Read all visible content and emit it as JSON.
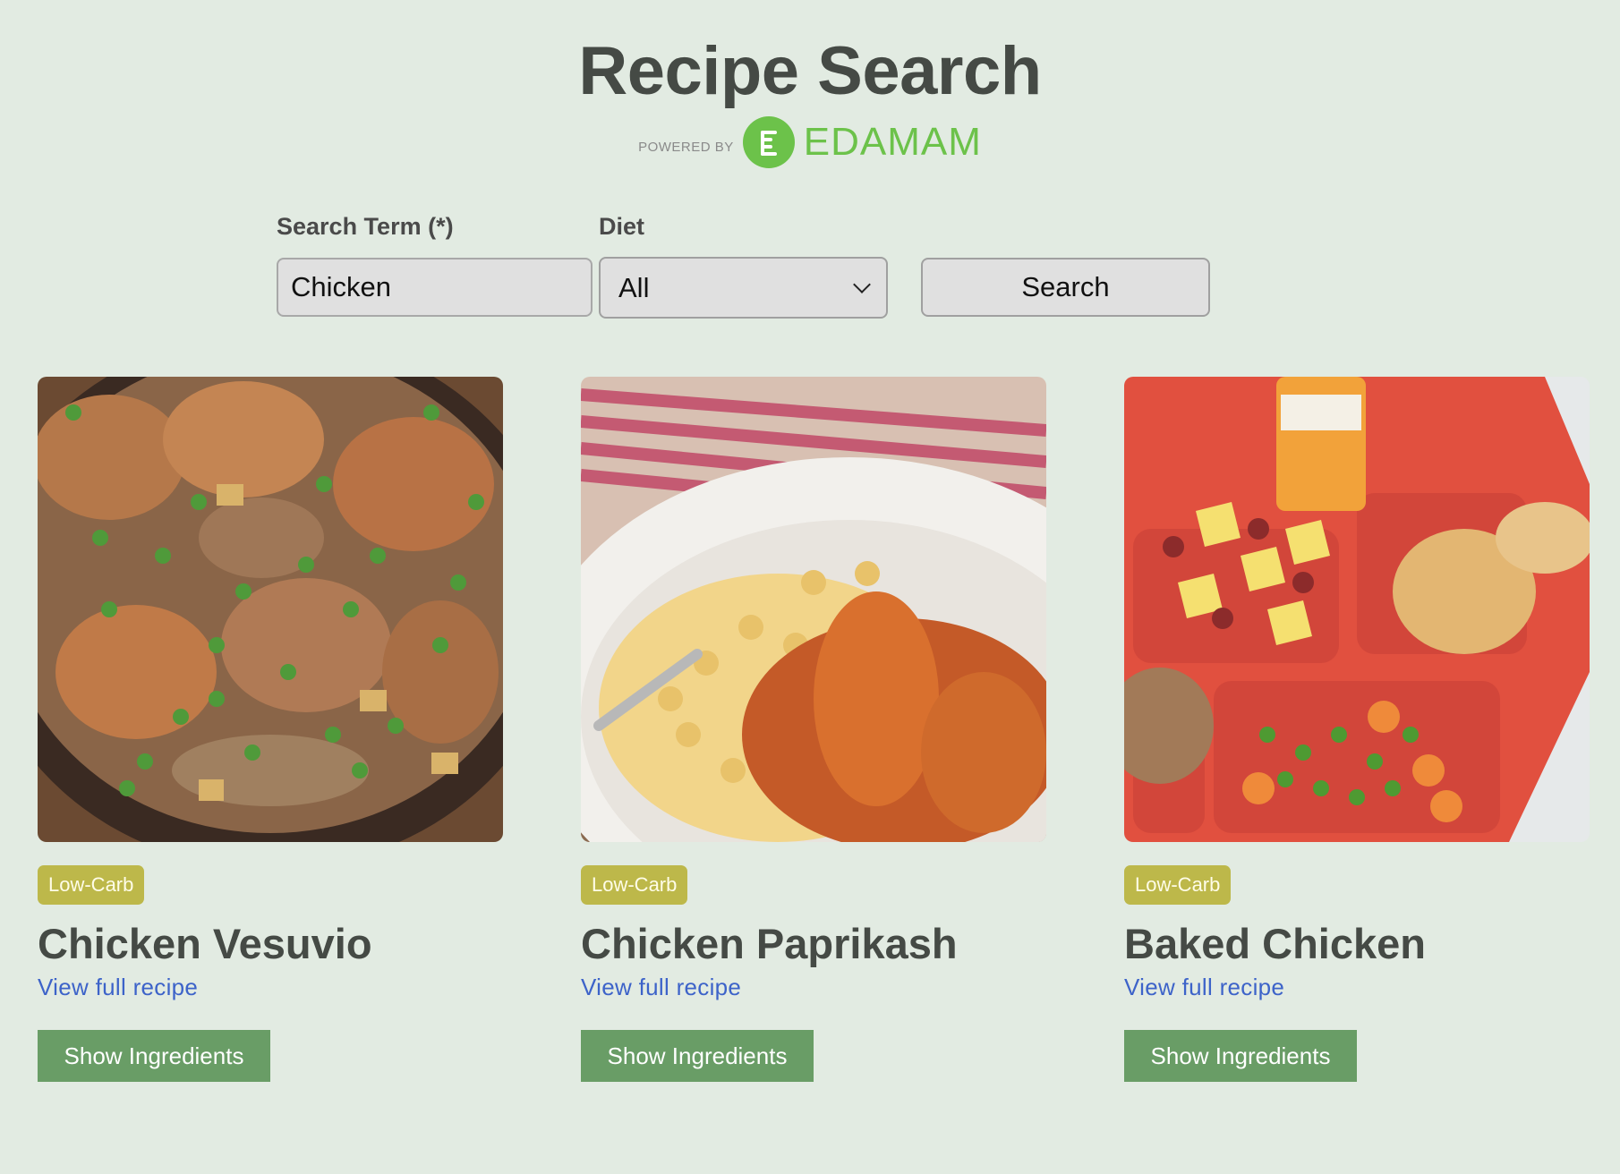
{
  "header": {
    "title": "Recipe Search",
    "powered_by": "POWERED BY",
    "brand": "EDAMAM"
  },
  "form": {
    "search_label": "Search Term (*)",
    "search_value": "Chicken",
    "diet_label": "Diet",
    "diet_selected": "All",
    "search_button": "Search"
  },
  "recipes": [
    {
      "badge": "Low-Carb",
      "title": "Chicken Vesuvio",
      "link": "View full recipe",
      "button": "Show Ingredients",
      "image": "chicken-vesuvio-photo"
    },
    {
      "badge": "Low-Carb",
      "title": "Chicken Paprikash",
      "link": "View full recipe",
      "button": "Show Ingredients",
      "image": "chicken-paprikash-photo"
    },
    {
      "badge": "Low-Carb",
      "title": "Baked Chicken",
      "link": "View full recipe",
      "button": "Show Ingredients",
      "image": "baked-chicken-tray-photo"
    }
  ],
  "colors": {
    "background": "#e2ebe2",
    "badge": "#bdb84a",
    "button": "#699d66",
    "link": "#3d63c9",
    "brand": "#6cc24a"
  }
}
